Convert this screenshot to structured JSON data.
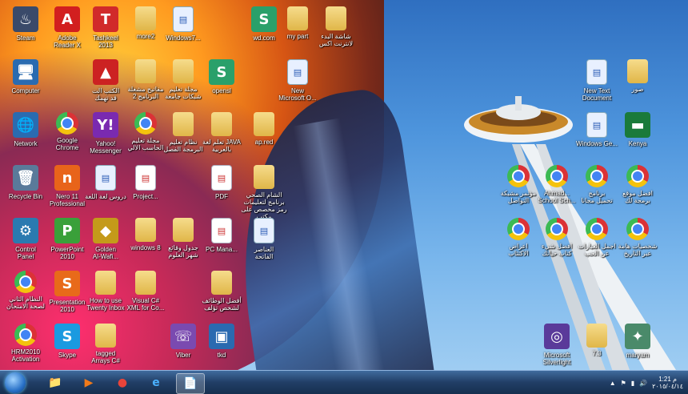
{
  "desktop": {
    "icons": [
      {
        "label": "Steam",
        "glyph": "♨",
        "color": "#3a4a6a",
        "type": "app"
      },
      {
        "label": "Adobe\nReader X",
        "glyph": "A",
        "color": "#d21f1f",
        "type": "app"
      },
      {
        "label": "Tashkeel\n2013",
        "glyph": "T",
        "color": "#d12a2a",
        "type": "app"
      },
      {
        "label": "more2",
        "glyph": "",
        "color": "",
        "type": "folder"
      },
      {
        "label": "Windows7...",
        "glyph": "",
        "color": "",
        "type": "word"
      },
      {
        "label": "wd.com",
        "glyph": "S",
        "color": "#2aa06a",
        "type": "app"
      },
      {
        "label": "my part",
        "glyph": "",
        "color": "",
        "type": "folder"
      },
      {
        "label": "شاشة البدء\nلانترنت اكس",
        "glyph": "",
        "color": "",
        "type": "folder"
      },
      {
        "label": "Computer",
        "glyph": "🖥",
        "color": "#2a6bb0",
        "type": "app"
      },
      {
        "label": "الكتب الت\nقد تهمك",
        "glyph": "▲",
        "color": "#c22",
        "type": "app"
      },
      {
        "label": "مفاتيح مشغلة\nالبرنامج 2",
        "glyph": "",
        "color": "",
        "type": "folder"
      },
      {
        "label": "مجلة تعليم\nشبكات جامعة",
        "glyph": "",
        "color": "",
        "type": "folder"
      },
      {
        "label": "opensl",
        "glyph": "S",
        "color": "#2aa06a",
        "type": "app"
      },
      {
        "label": "New\nMicrosoft O...",
        "glyph": "W",
        "color": "",
        "type": "word"
      },
      {
        "label": "New Text\nDocument",
        "glyph": "",
        "color": "",
        "type": "word"
      },
      {
        "label": "صور",
        "glyph": "",
        "color": "",
        "type": "folder"
      },
      {
        "label": "Network",
        "glyph": "🌐",
        "color": "#2a6bb0",
        "type": "app"
      },
      {
        "label": "Google\nChrome",
        "glyph": "",
        "color": "",
        "type": "chrome"
      },
      {
        "label": "Yahoo!\nMessenger",
        "glyph": "Y!",
        "color": "#7a2ab0",
        "type": "app"
      },
      {
        "label": "مجلة تعليم\nالحاسب الالي",
        "glyph": "",
        "color": "",
        "type": "chrome"
      },
      {
        "label": "نظام تعليم\nالبرمجة الفصل",
        "glyph": "",
        "color": "",
        "type": "folder"
      },
      {
        "label": "تعلم لغة JAVA\nبالعربية",
        "glyph": "",
        "color": "",
        "type": "folder"
      },
      {
        "label": "ap.red",
        "glyph": "",
        "color": "",
        "type": "folder"
      },
      {
        "label": "Windows Ge...",
        "glyph": "",
        "color": "",
        "type": "word"
      },
      {
        "label": "Kenya",
        "glyph": "▬",
        "color": "#1a7a3a",
        "type": "app"
      },
      {
        "label": "Recycle Bin",
        "glyph": "🗑",
        "color": "#5a7a9a",
        "type": "app"
      },
      {
        "label": "Nero 11\nProfessional",
        "glyph": "n",
        "color": "#e8641a",
        "type": "app"
      },
      {
        "label": "دروس لغة اللغة",
        "glyph": "W",
        "color": "",
        "type": "word"
      },
      {
        "label": "Project...",
        "glyph": "",
        "color": "",
        "type": "doc"
      },
      {
        "label": "PDF",
        "glyph": "PDF",
        "color": "",
        "type": "doc"
      },
      {
        "label": "الشام الصحي برنامج لتعليمات\nرمز مخصص على مكتب",
        "glyph": "",
        "color": "",
        "type": "folder"
      },
      {
        "label": "مؤتمر مشبكة\nالتواصل",
        "glyph": "",
        "color": "",
        "type": "chrome"
      },
      {
        "label": "Ahmad...\nSchool Sch...",
        "glyph": "",
        "color": "",
        "type": "chrome"
      },
      {
        "label": "برنامج\nتحميل مجانا",
        "glyph": "",
        "color": "",
        "type": "chrome"
      },
      {
        "label": "افضل موقع\nبرمجة لك",
        "glyph": "",
        "color": "",
        "type": "chrome"
      },
      {
        "label": "Control\nPanel",
        "glyph": "⚙",
        "color": "#2a7ab0",
        "type": "app"
      },
      {
        "label": "PowerPoint\n2010",
        "glyph": "P",
        "color": "#3aa03a",
        "type": "app"
      },
      {
        "label": "Golden\nAl-Wafi...",
        "glyph": "◆",
        "color": "#c49a1a",
        "type": "app"
      },
      {
        "label": "windows 8",
        "glyph": "",
        "color": "",
        "type": "folder"
      },
      {
        "label": "جدول وقائع\nشهر العلوم",
        "glyph": "",
        "color": "",
        "type": "folder"
      },
      {
        "label": "PC Mana...",
        "glyph": "",
        "color": "",
        "type": "doc"
      },
      {
        "label": "العناصر\nالفاتحة",
        "glyph": "",
        "color": "",
        "type": "word"
      },
      {
        "label": "اعراض\nالاكتئاب",
        "glyph": "",
        "color": "",
        "type": "chrome"
      },
      {
        "label": "افضل شيء\nكتاب حياتك",
        "glyph": "",
        "color": "",
        "type": "chrome"
      },
      {
        "label": "اجمل العبارات\nعن الحب",
        "glyph": "",
        "color": "",
        "type": "chrome"
      },
      {
        "label": "شخصيات هامة\nعبر التاريخ",
        "glyph": "",
        "color": "",
        "type": "chrome"
      },
      {
        "label": "النظام الثاني\nلصحة الامتحان",
        "glyph": "",
        "color": "",
        "type": "chrome"
      },
      {
        "label": "Presentation\n2010",
        "glyph": "S",
        "color": "#e86a1a",
        "type": "app"
      },
      {
        "label": "How to use\nTwenty Inbox",
        "glyph": "",
        "color": "",
        "type": "folder"
      },
      {
        "label": "Visual C#\nXML for Co...",
        "glyph": "",
        "color": "",
        "type": "folder"
      },
      {
        "label": "أفضل الوظائف\nلشخص تؤلف",
        "glyph": "",
        "color": "",
        "type": "folder"
      },
      {
        "label": "HRM2010\nActivation",
        "glyph": "",
        "color": "",
        "type": "chrome"
      },
      {
        "label": "Skype",
        "glyph": "S",
        "color": "#1a9ae0",
        "type": "app"
      },
      {
        "label": "tagged\nArrays C#",
        "glyph": "",
        "color": "",
        "type": "folder"
      },
      {
        "label": "Viber",
        "glyph": "☏",
        "color": "#7a4ab0",
        "type": "app"
      },
      {
        "label": "tkd",
        "glyph": "▣",
        "color": "#2a6ab0",
        "type": "app"
      },
      {
        "label": "Microsoft\nSilverlight",
        "glyph": "◎",
        "color": "#5a3a9a",
        "type": "app"
      },
      {
        "label": "7.3",
        "glyph": "",
        "color": "",
        "type": "folder"
      },
      {
        "label": "maryam",
        "glyph": "✦",
        "color": "#4a8a6a",
        "type": "app"
      }
    ]
  },
  "taskbar": {
    "items": [
      {
        "name": "explorer",
        "glyph": "📁"
      },
      {
        "name": "media-player",
        "glyph": "▶"
      },
      {
        "name": "chrome",
        "glyph": "●"
      },
      {
        "name": "internet-explorer",
        "glyph": "e"
      },
      {
        "name": "notepad",
        "glyph": "📄"
      }
    ],
    "clock_time": "1:21 م",
    "clock_date": "٢٠١٥/٠٤/١٤"
  }
}
